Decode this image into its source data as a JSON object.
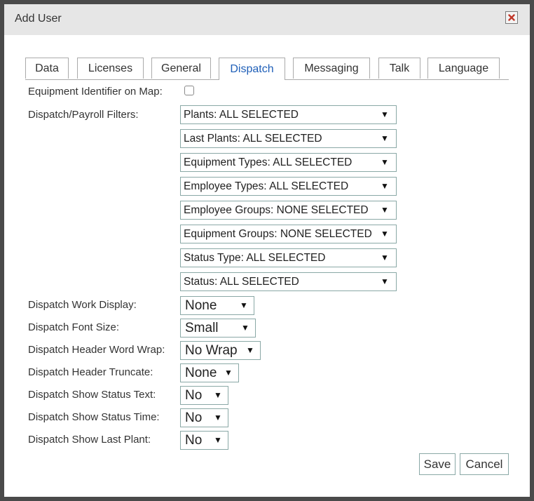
{
  "dialog": {
    "title": "Add User",
    "close_icon": "close-x-icon",
    "close_color": "#c0392b"
  },
  "tabs": [
    {
      "label": "Data"
    },
    {
      "label": "Licenses"
    },
    {
      "label": "General"
    },
    {
      "label": "Dispatch",
      "active": true
    },
    {
      "label": "Messaging"
    },
    {
      "label": "Talk"
    },
    {
      "label": "Language"
    }
  ],
  "equipment_identifier": {
    "label": "Equipment Identifier on Map:",
    "checked": false
  },
  "filters": {
    "label": "Dispatch/Payroll Filters:",
    "items": [
      "Plants: ALL SELECTED",
      "Last Plants: ALL SELECTED",
      "Equipment Types: ALL SELECTED",
      "Employee Types: ALL SELECTED",
      "Employee Groups: NONE SELECTED",
      "Equipment Groups: NONE SELECTED",
      "Status Type: ALL SELECTED",
      "Status: ALL SELECTED"
    ]
  },
  "settings": [
    {
      "label": "Dispatch Work Display:",
      "value": "None"
    },
    {
      "label": "Dispatch Font Size:",
      "value": "Small"
    },
    {
      "label": "Dispatch Header Word Wrap:",
      "value": "No Wrap"
    },
    {
      "label": "Dispatch Header Truncate:",
      "value": "None"
    },
    {
      "label": "Dispatch Show Status Text:",
      "value": "No"
    },
    {
      "label": "Dispatch Show Status Time:",
      "value": "No"
    },
    {
      "label": "Dispatch Show Last Plant:",
      "value": "No"
    }
  ],
  "dropdown_arrow": "▼",
  "buttons": {
    "save": "Save",
    "cancel": "Cancel"
  },
  "colors": {
    "active_tab": "#1f5fb8",
    "border": "#8aa8a6"
  }
}
